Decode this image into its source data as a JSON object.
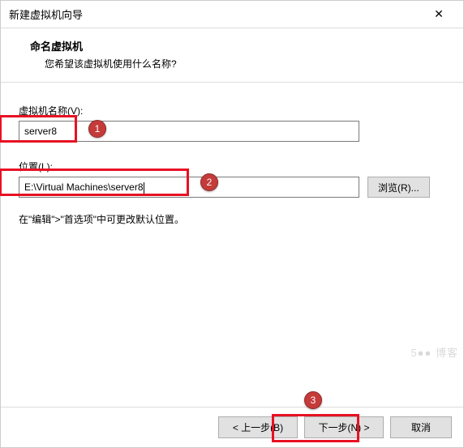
{
  "window": {
    "title": "新建虚拟机向导"
  },
  "header": {
    "title": "命名虚拟机",
    "subtitle": "您希望该虚拟机使用什么名称?"
  },
  "fields": {
    "name_label": "虚拟机名称(V):",
    "name_value": "server8",
    "location_label": "位置(L):",
    "location_value": "E:\\Virtual Machines\\server8",
    "browse_label": "浏览(R)..."
  },
  "hint": "在\"编辑\">\"首选项\"中可更改默认位置。",
  "footer": {
    "back": "< 上一步(B)",
    "next": "下一步(N) >",
    "cancel": "取消"
  },
  "callouts": {
    "c1": "1",
    "c2": "2",
    "c3": "3"
  },
  "watermark": "5●● 博客"
}
